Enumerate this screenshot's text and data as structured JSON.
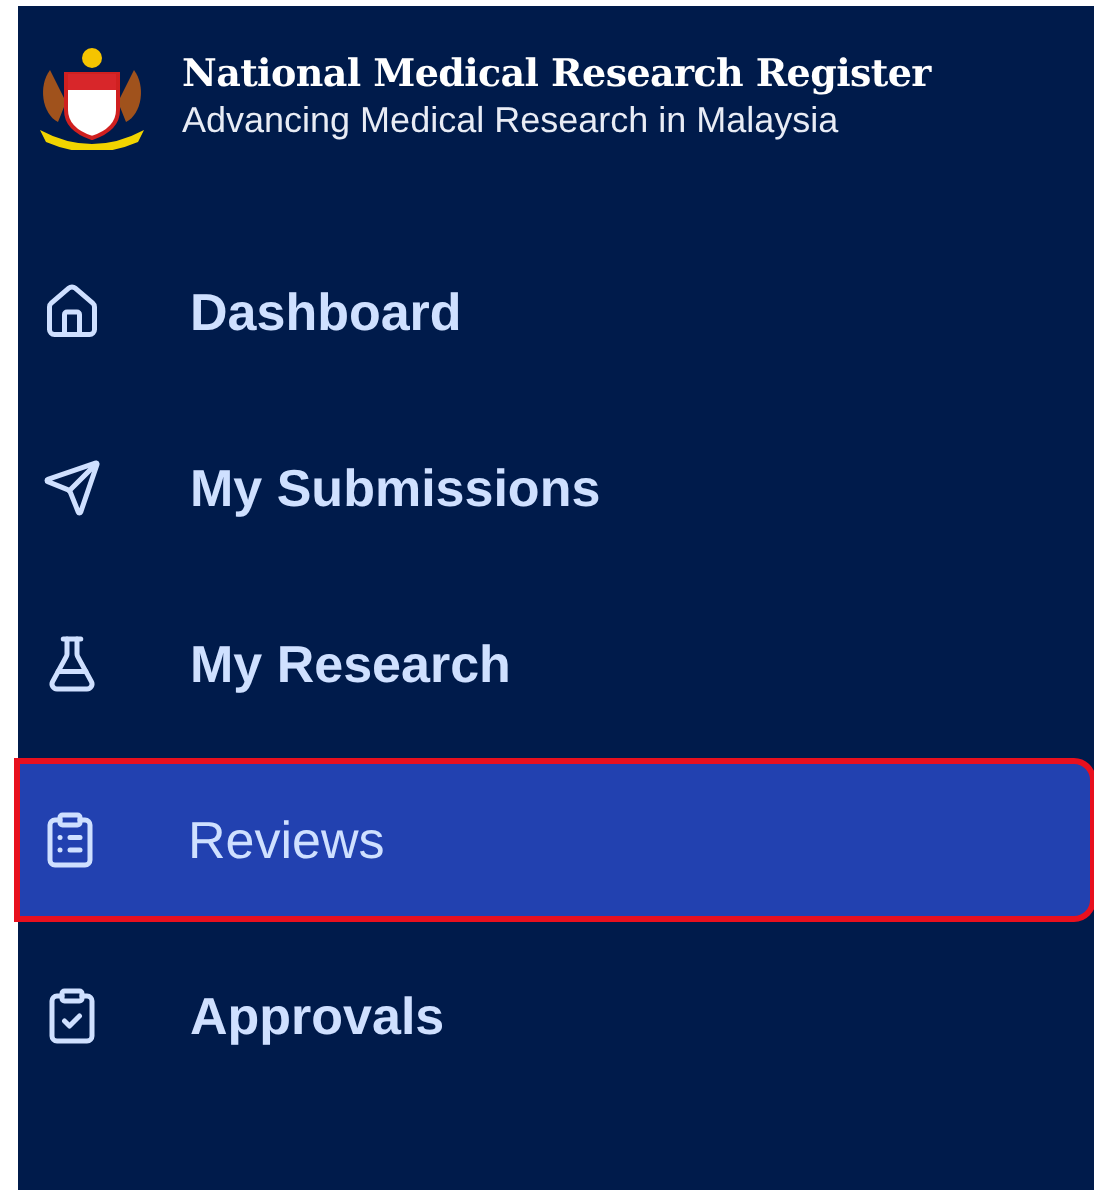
{
  "header": {
    "title": "National Medical Research Register",
    "subtitle": "Advancing Medical Research in Malaysia"
  },
  "nav": [
    {
      "kind": "home",
      "label": "Dashboard",
      "selected": false,
      "highlighted": false
    },
    {
      "kind": "send",
      "label": "My Submissions",
      "selected": false,
      "highlighted": false
    },
    {
      "kind": "flask",
      "label": "My Research",
      "selected": false,
      "highlighted": false
    },
    {
      "kind": "review",
      "label": "Reviews",
      "selected": true,
      "highlighted": true
    },
    {
      "kind": "approve",
      "label": "Approvals",
      "selected": false,
      "highlighted": false
    }
  ]
}
